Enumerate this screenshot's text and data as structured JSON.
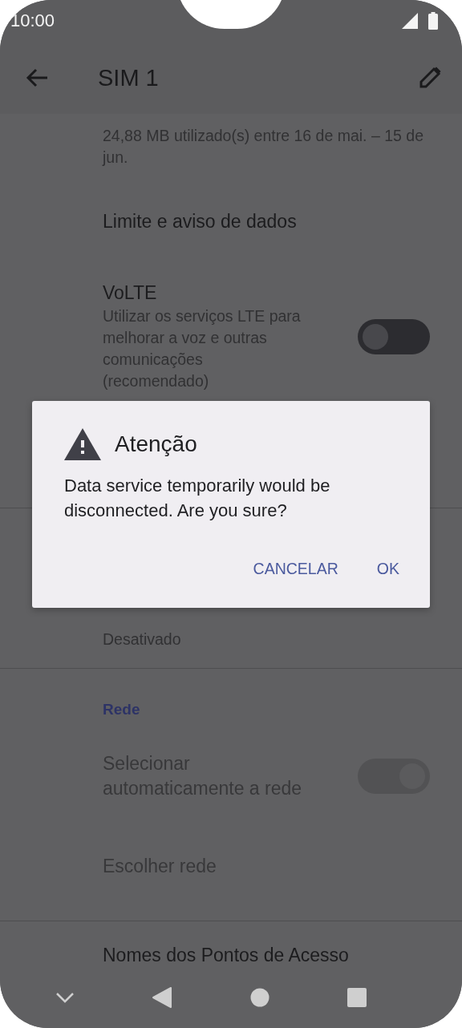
{
  "status_bar": {
    "time": "10:00"
  },
  "app_bar": {
    "title": "SIM 1"
  },
  "groups": [
    {
      "items": [
        {
          "kind": "cut",
          "summary": "24,88 MB utilizado(s) entre 16 de mai. – 15 de jun."
        },
        {
          "kind": "plain",
          "title": "Limite e aviso de dados"
        },
        {
          "kind": "switch",
          "title": "VoLTE",
          "summary": "Utilizar os serviços LTE para melhorar a voz e outras comunicações (recomendado)",
          "on": false,
          "disabled": false
        },
        {
          "kind": "covered"
        }
      ]
    },
    {
      "items": [
        {
          "kind": "summary_only",
          "summary": "Desativado"
        }
      ]
    },
    {
      "items": [
        {
          "kind": "category",
          "title": "Rede"
        },
        {
          "kind": "switch",
          "title": "Selecionar automaticamente a rede",
          "on": true,
          "disabled": true
        },
        {
          "kind": "plain",
          "title": "Escolher rede",
          "disabled": true
        }
      ]
    },
    {
      "items": [
        {
          "kind": "plain",
          "title": "Nomes dos Pontos de Acesso"
        }
      ]
    }
  ],
  "dialog": {
    "title": "Atenção",
    "message": "Data service temporarily would be disconnected. Are you sure?",
    "buttons": [
      "CANCELAR",
      "OK"
    ]
  }
}
